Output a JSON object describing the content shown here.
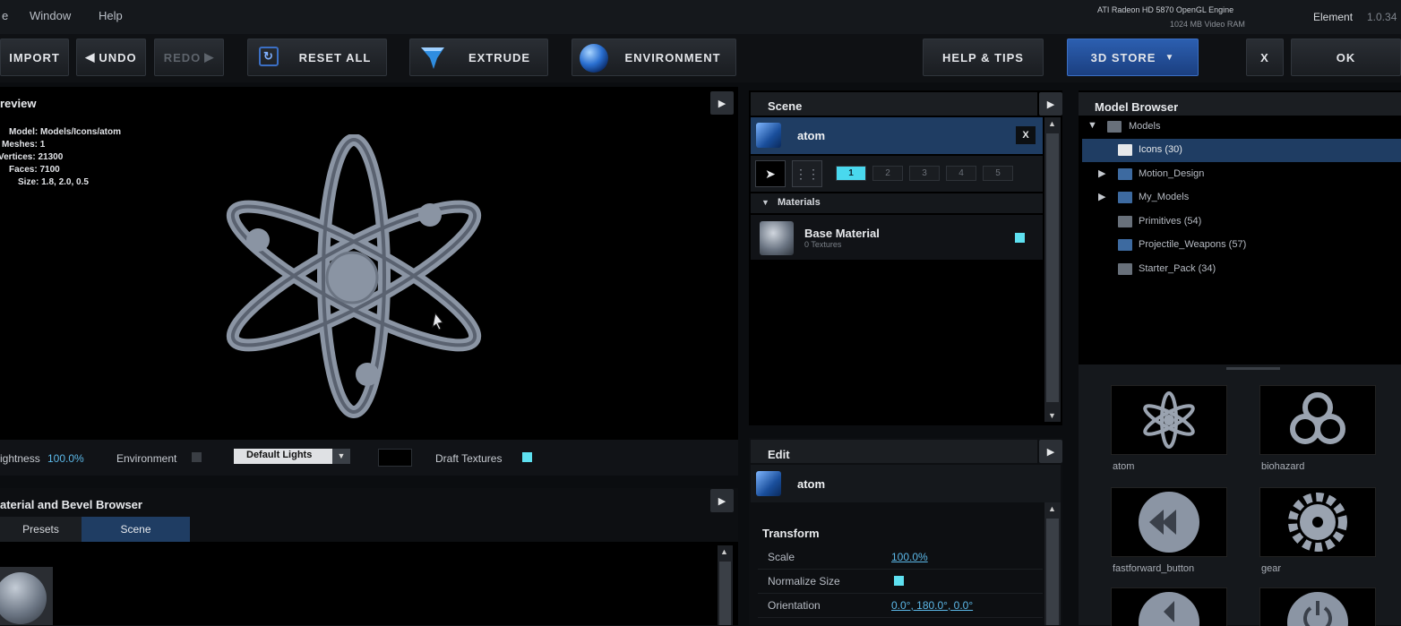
{
  "menubar": {
    "items": [
      "e",
      "Window",
      "Help"
    ],
    "gpu_line1": "ATI Radeon HD 5870 OpenGL Engine",
    "gpu_line2": "1024 MB Video RAM",
    "product": "Element",
    "version": "1.0.34"
  },
  "toolbar": {
    "import": "IMPORT",
    "undo": "UNDO",
    "redo": "REDO",
    "reset_all": "RESET ALL",
    "extrude": "EXTRUDE",
    "environment": "ENVIRONMENT",
    "help_tips": "HELP & TIPS",
    "store": "3D STORE",
    "close": "X",
    "ok": "OK"
  },
  "preview": {
    "title": "review",
    "info": [
      "Model: Models/Icons/atom",
      "Meshes: 1",
      "Vertices: 21300",
      "Faces: 7100",
      "Size: 1.8, 2.0, 0.5"
    ],
    "brightness_label": "ightness",
    "brightness_value": "100.0%",
    "environment_label": "Environment",
    "lights_value": "Default Lights",
    "draft_label": "Draft Textures"
  },
  "material_browser": {
    "title": "aterial and Bevel Browser",
    "tabs": [
      "Presets",
      "Scene"
    ]
  },
  "scene": {
    "title": "Scene",
    "object_name": "atom",
    "close": "X",
    "layers": [
      "1",
      "2",
      "3",
      "4",
      "5"
    ],
    "materials_header": "Materials",
    "material_name": "Base Material",
    "material_sub": "0 Textures"
  },
  "edit": {
    "title": "Edit",
    "object_name": "atom",
    "transform_header": "Transform",
    "scale_label": "Scale",
    "scale_value": "100.0%",
    "normalize_label": "Normalize Size",
    "orientation_label": "Orientation",
    "orientation_value": "0.0°, 180.0°, 0.0°"
  },
  "model_browser": {
    "title": "Model Browser",
    "root": "Models",
    "folders": [
      "Icons (30)",
      "Motion_Design",
      "My_Models",
      "Primitives (54)",
      "Projectile_Weapons (57)",
      "Starter_Pack (34)"
    ],
    "thumbnails": [
      "atom",
      "biohazard",
      "fastforward_button",
      "gear"
    ]
  },
  "colors": {
    "accent_cyan": "#5ee0f0",
    "store_blue": "#2c5fb0",
    "selection_blue": "#1f3d63"
  }
}
